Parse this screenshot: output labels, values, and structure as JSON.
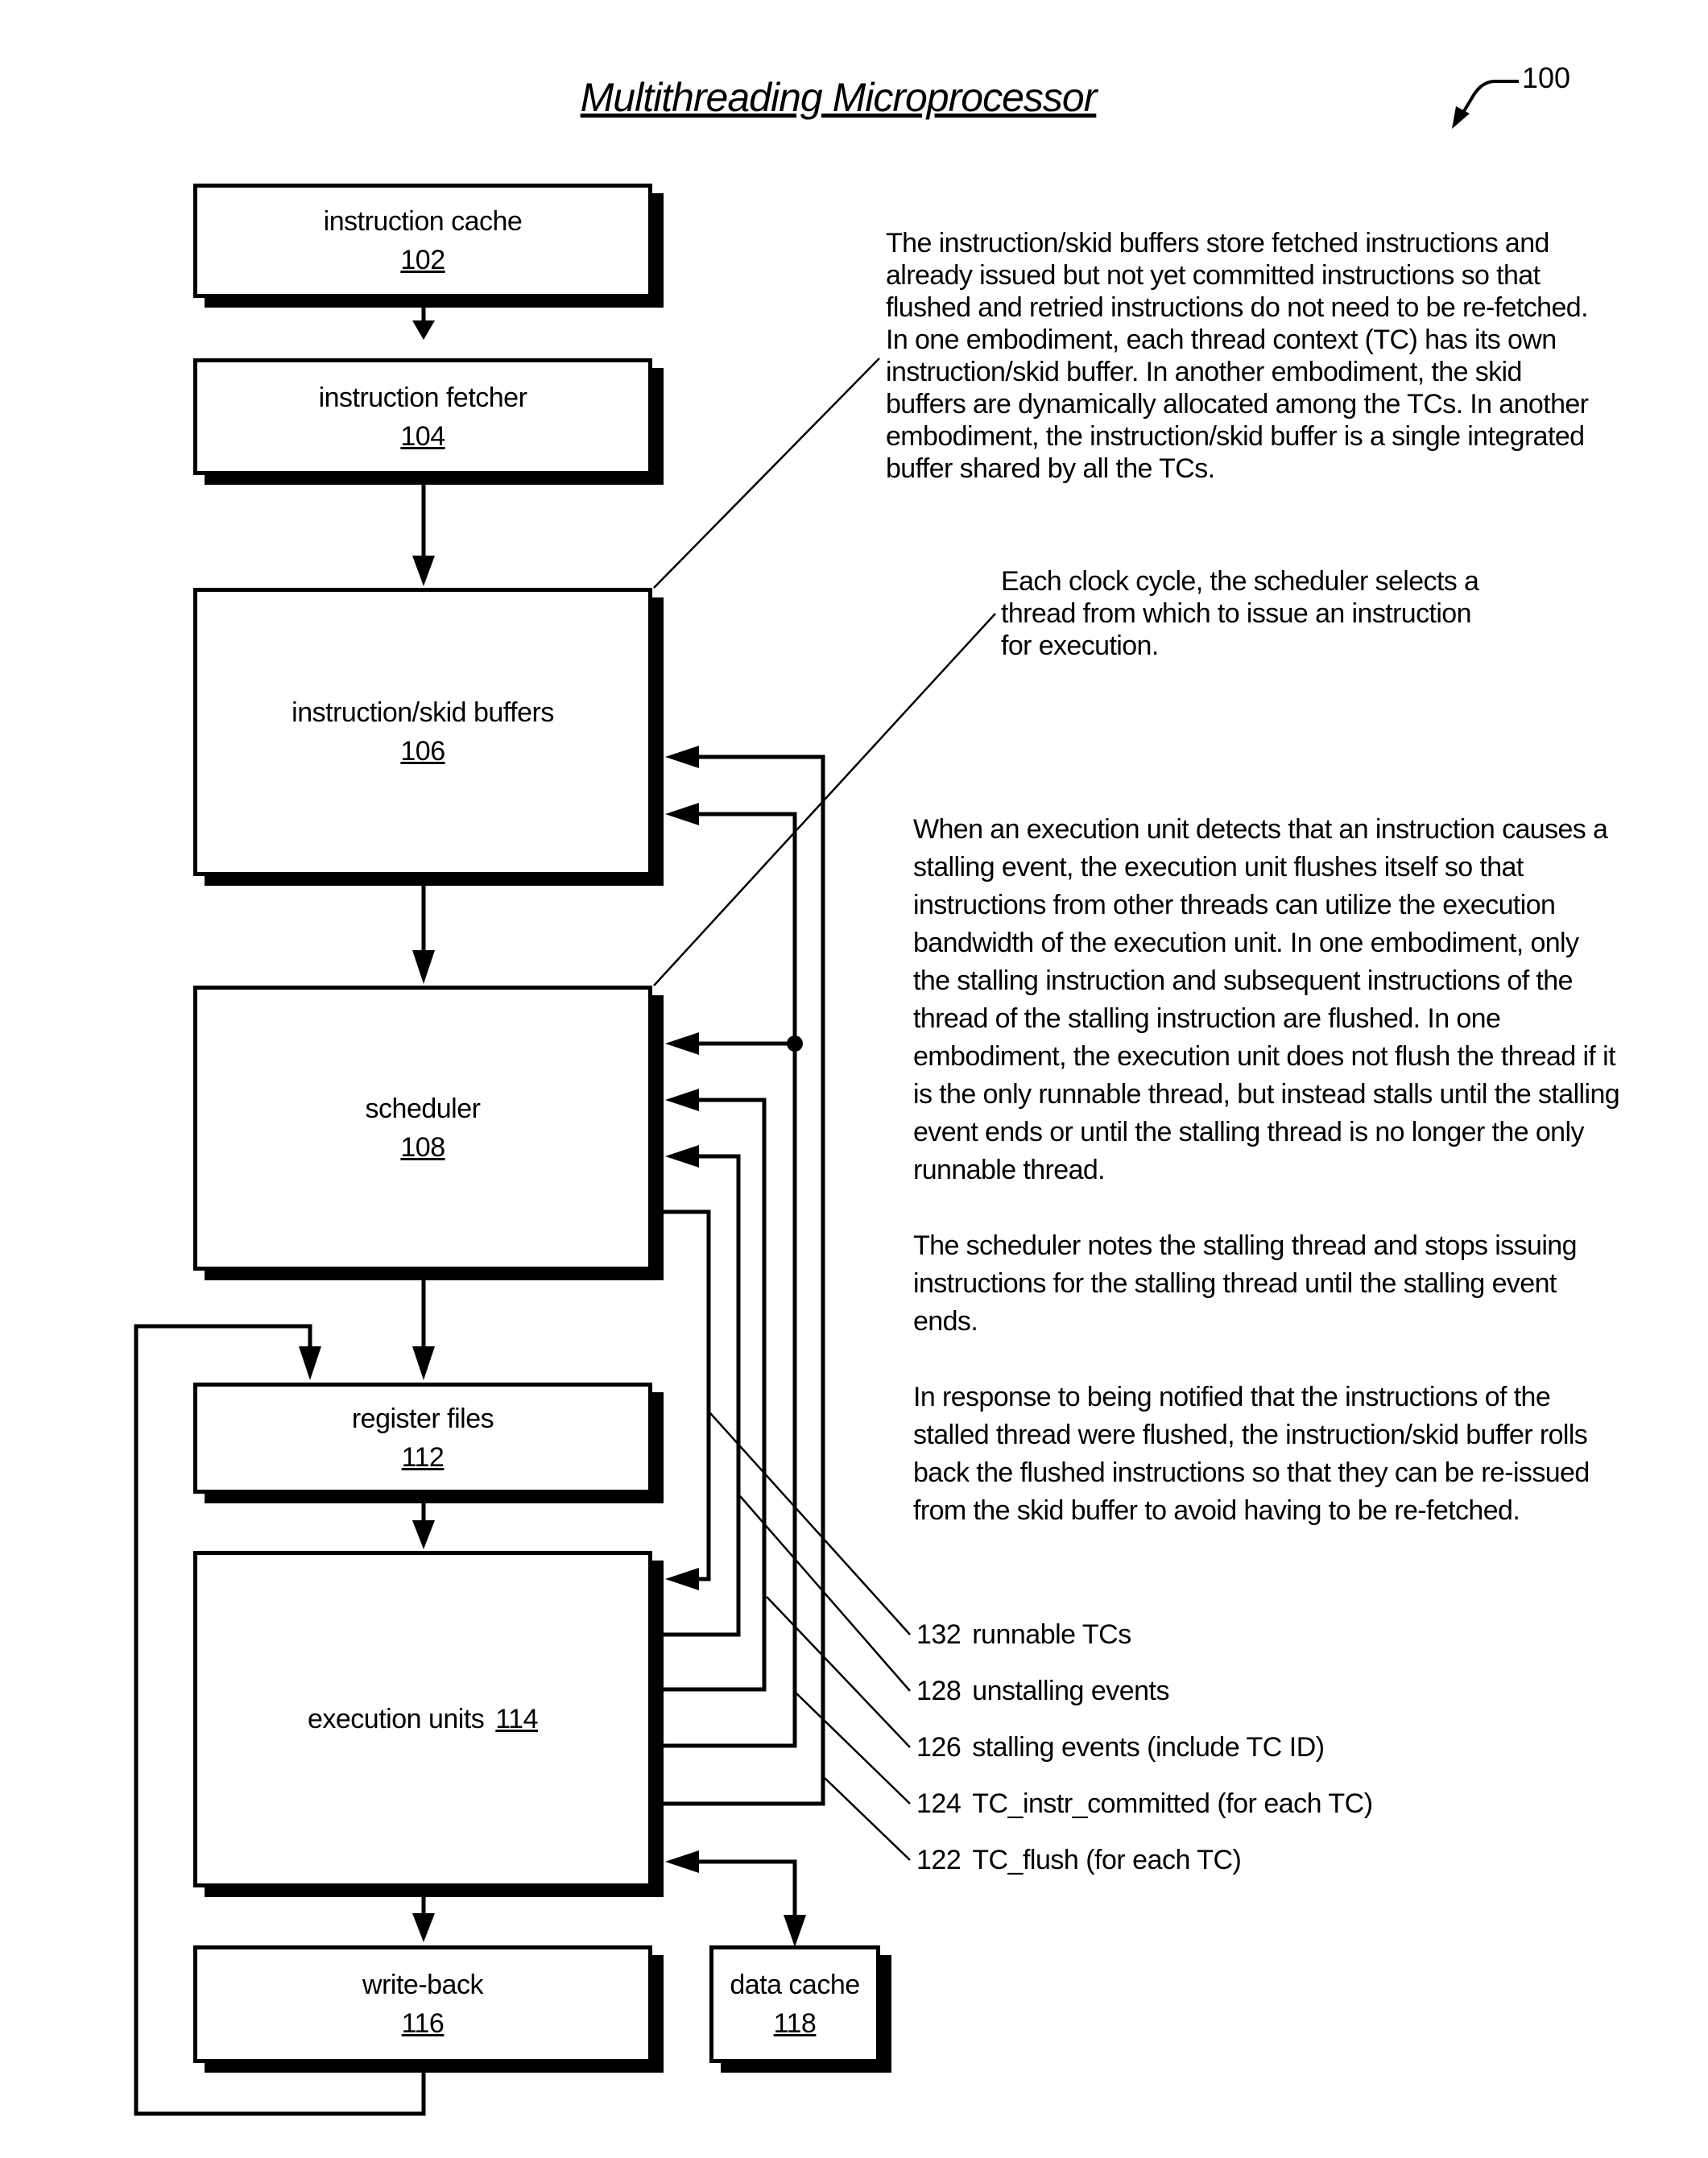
{
  "title": "Multithreading Microprocessor",
  "figure_ref": "100",
  "blocks": {
    "instruction_cache": {
      "label": "instruction cache",
      "ref": "102"
    },
    "instruction_fetcher": {
      "label": "instruction fetcher",
      "ref": "104"
    },
    "skid_buffers": {
      "label": "instruction/skid buffers",
      "ref": "106"
    },
    "scheduler": {
      "label": "scheduler",
      "ref": "108"
    },
    "register_files": {
      "label": "register files",
      "ref": "112"
    },
    "execution_units": {
      "label": "execution units",
      "ref": "114"
    },
    "write_back": {
      "label": "write-back",
      "ref": "116"
    },
    "data_cache": {
      "label": "data cache",
      "ref": "118"
    }
  },
  "notes": {
    "skid_buffers_note": "The instruction/skid buffers store fetched instructions and already issued but not yet committed instructions so that flushed and retried instructions do not need to be re-fetched. In one embodiment, each thread context (TC) has its own instruction/skid buffer.  In another embodiment, the skid buffers are dynamically allocated among the TCs.  In another embodiment, the instruction/skid buffer is a single integrated buffer shared by all the TCs.",
    "scheduler_note": "Each clock cycle, the scheduler selects a thread from which to issue an instruction for execution.",
    "execution_note_1": "When an execution unit detects that an instruction causes a stalling event, the execution unit flushes itself so that instructions from other threads can utilize the execution bandwidth of the execution unit.  In one embodiment, only the stalling instruction and subsequent instructions of the thread of the stalling instruction are flushed.  In one embodiment, the execution unit does not flush the thread if it is the only runnable thread, but instead stalls until the stalling event ends or until the stalling thread is no longer the only runnable thread.",
    "execution_note_2": "The scheduler notes the stalling thread and stops issuing instructions for the stalling thread until the  stalling event ends.",
    "execution_note_3": "In response to being notified that the instructions of the stalled thread were flushed, the instruction/skid buffer rolls back the flushed instructions so that they can be re-issued from the skid buffer to avoid having to be re-fetched."
  },
  "signals": [
    {
      "code": "132",
      "label": "runnable TCs"
    },
    {
      "code": "128",
      "label": "unstalling events"
    },
    {
      "code": "126",
      "label": "stalling events (include TC ID)"
    },
    {
      "code": "124",
      "label": "TC_instr_committed (for each TC)"
    },
    {
      "code": "122",
      "label": "TC_flush (for each TC)"
    }
  ]
}
